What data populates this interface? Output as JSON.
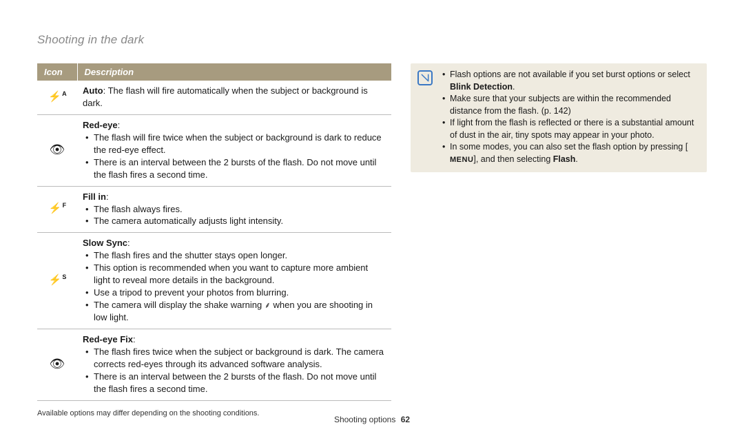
{
  "page_title": "Shooting in the dark",
  "table": {
    "headers": {
      "icon": "Icon",
      "desc": "Description"
    },
    "rows": [
      {
        "icon_name": "flash-auto-icon",
        "heading": "Auto",
        "heading_suffix": ": The flash will fire automatically when the subject or background is dark."
      },
      {
        "icon_name": "red-eye-icon",
        "heading": "Red-eye",
        "heading_suffix": ":",
        "bullets": [
          "The flash will fire twice when the subject or background is dark to reduce the red-eye effect.",
          "There is an interval between the 2 bursts of the flash. Do not move until the flash fires a second time."
        ]
      },
      {
        "icon_name": "flash-fill-icon",
        "heading": "Fill in",
        "heading_suffix": ":",
        "bullets": [
          "The flash always fires.",
          "The camera automatically adjusts light intensity."
        ]
      },
      {
        "icon_name": "flash-slow-sync-icon",
        "heading": "Slow Sync",
        "heading_suffix": ":",
        "bullets": [
          "The flash fires and the shutter stays open longer.",
          "This option is recommended when you want to capture more ambient light to reveal more details in the background.",
          "Use a tripod to prevent your photos from blurring.",
          "The camera will display the shake warning {shake} when you are shooting in low light."
        ]
      },
      {
        "icon_name": "red-eye-fix-icon",
        "heading": "Red-eye Fix",
        "heading_suffix": ":",
        "bullets": [
          "The flash fires twice when the subject or background is dark. The camera corrects red-eyes through its advanced software analysis.",
          "There is an interval between the 2 bursts of the flash. Do not move until the flash fires a second time."
        ]
      }
    ]
  },
  "footnote": "Available options may differ depending on the shooting conditions.",
  "note": {
    "bullets": [
      {
        "prefix": "Flash options are not available if you set burst options or select ",
        "bold": "Blink Detection",
        "suffix": "."
      },
      {
        "text": "Make sure that your subjects are within the recommended distance from the flash. (p. 142)"
      },
      {
        "text": "If light from the flash is reflected or there is a substantial amount of dust in the air, tiny spots may appear in your photo."
      },
      {
        "prefix": "In some modes, you can also set the flash option by pressing [",
        "menu": "MENU",
        "mid": "], and then selecting ",
        "bold": "Flash",
        "suffix": "."
      }
    ]
  },
  "footer": {
    "section": "Shooting options",
    "page": "62"
  }
}
